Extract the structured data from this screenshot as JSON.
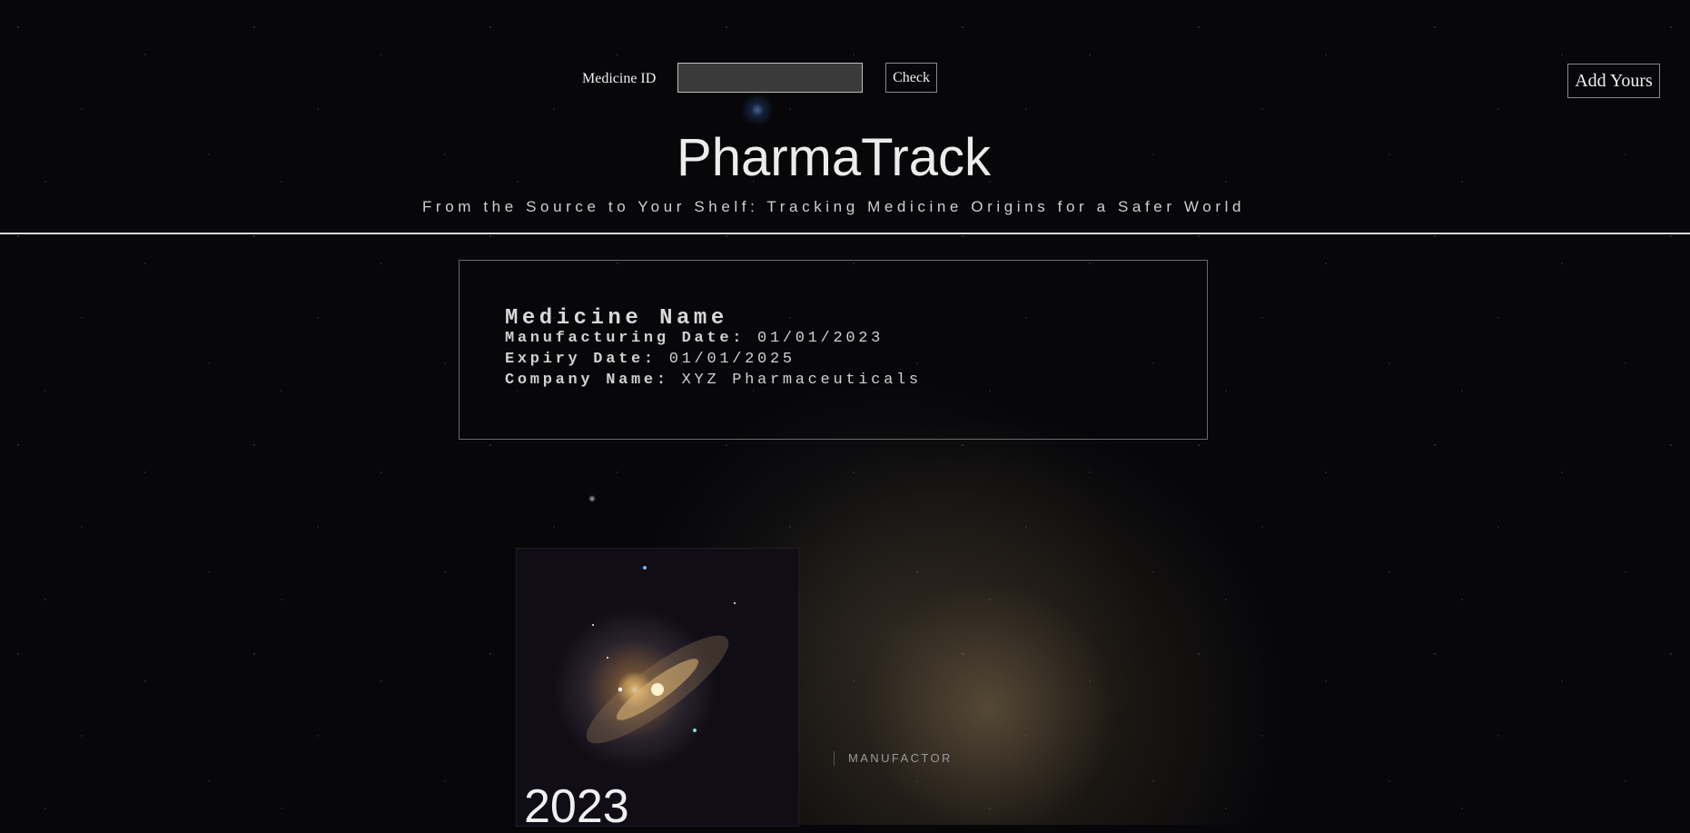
{
  "search": {
    "label": "Medicine ID",
    "value": "",
    "placeholder": "",
    "check_label": "Check"
  },
  "header": {
    "add_label": "Add Yours",
    "title": "PharmaTrack",
    "subtitle": "From the Source to Your Shelf: Tracking Medicine Origins for a Safer World"
  },
  "medicine": {
    "name": "Medicine Name",
    "manufacturing_label": "Manufacturing Date:",
    "manufacturing_value": "01/01/2023",
    "expiry_label": "Expiry Date:",
    "expiry_value": "01/01/2025",
    "company_label": "Company Name:",
    "company_value": "XYZ Pharmaceuticals"
  },
  "timeline": {
    "year": "2023",
    "tag": "MANUFACTOR"
  },
  "colors": {
    "background": "#07070a",
    "text": "#e6e6e6",
    "border": "#6a6a6a"
  }
}
